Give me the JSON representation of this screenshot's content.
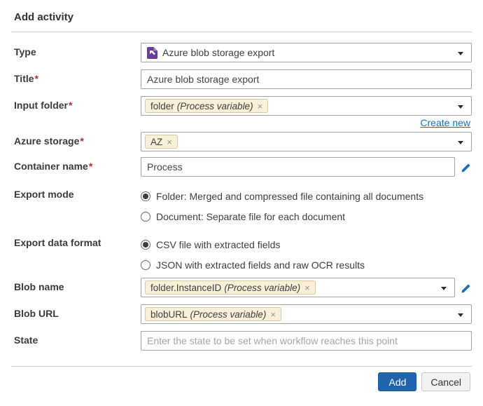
{
  "header": {
    "title": "Add activity"
  },
  "form": {
    "type": {
      "label": "Type",
      "value": "Azure blob storage export"
    },
    "title": {
      "label": "Title",
      "required": "*",
      "value": "Azure blob storage export"
    },
    "input_folder": {
      "label": "Input folder",
      "required": "*",
      "tag": {
        "name": "folder",
        "kind": "(Process variable)",
        "remove": "×"
      }
    },
    "create_new_label": "Create new",
    "azure_storage": {
      "label": "Azure storage",
      "required": "*",
      "tag": {
        "name": "AZ",
        "kind": "",
        "remove": "×"
      }
    },
    "container_name": {
      "label": "Container name",
      "required": "*",
      "value": "Process"
    },
    "export_mode": {
      "label": "Export mode",
      "options": [
        {
          "label": "Folder: Merged and compressed file containing all documents",
          "selected": true
        },
        {
          "label": "Document: Separate file for each document",
          "selected": false
        }
      ]
    },
    "export_data_format": {
      "label": "Export data format",
      "options": [
        {
          "label": "CSV file with extracted fields",
          "selected": true
        },
        {
          "label": "JSON with extracted fields and raw OCR results",
          "selected": false
        }
      ]
    },
    "blob_name": {
      "label": "Blob name",
      "tag": {
        "name": "folder.InstanceID",
        "kind": "(Process variable)",
        "remove": "×"
      }
    },
    "blob_url": {
      "label": "Blob URL",
      "tag": {
        "name": "blobURL",
        "kind": "(Process variable)",
        "remove": "×"
      }
    },
    "state": {
      "label": "State",
      "placeholder": "Enter the state to be set when workflow reaches this point"
    }
  },
  "footer": {
    "add_label": "Add",
    "cancel_label": "Cancel"
  },
  "colors": {
    "accent_blue": "#1f64ad",
    "link_blue": "#1a6fb5",
    "tag_bg": "#faf0da",
    "tag_border": "#d8c8a4",
    "required_red": "#c2282e",
    "icon_purple": "#6b3d97"
  }
}
